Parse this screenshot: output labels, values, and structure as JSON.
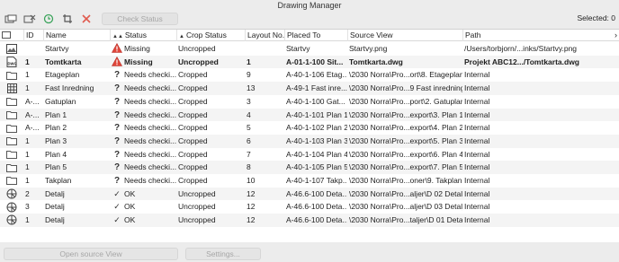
{
  "window": {
    "title": "Drawing Manager"
  },
  "toolbar": {
    "check_status_label": "Check Status",
    "selected_text": "Selected: 0",
    "icons": [
      "drawing-place-icon",
      "drawing-remove-icon",
      "refresh-icon",
      "crop-icon",
      "delete-x-icon"
    ],
    "delete_color": "#e05a4e",
    "refresh_color": "#3aa35a"
  },
  "columns": [
    "ID",
    "Name",
    "Status",
    "Crop Status",
    "Layout No.",
    "Placed To",
    "Source View",
    "Path"
  ],
  "rows": [
    {
      "type": "image",
      "id": "",
      "name": "Startvy",
      "status_icon": "warning",
      "status": "Missing",
      "crop": "Uncropped",
      "layout": "",
      "placed": "Startvy",
      "source": "Startvy.png",
      "path": "/Users/torbjorn/...inks/Startvy.png",
      "bold": false
    },
    {
      "type": "dwg",
      "id": "1",
      "name": "Tomtkarta",
      "status_icon": "warning",
      "status": "Missing",
      "crop": "Uncropped",
      "layout": "1",
      "placed": "A-01-1-100 Sit...",
      "source": "Tomtkarta.dwg",
      "path": "Projekt ABC12.../Tomtkarta.dwg",
      "bold": true
    },
    {
      "type": "folder",
      "id": "1",
      "name": "Etageplan",
      "status_icon": "question",
      "status": "Needs checki...",
      "crop": "Cropped",
      "layout": "9",
      "placed": "A-40-1-106 Etag...",
      "source": "\\2030 Norra\\Pro...ort\\8. Etageplan",
      "path": "Internal",
      "bold": false
    },
    {
      "type": "grid",
      "id": "1",
      "name": "Fast Inredning",
      "status_icon": "question",
      "status": "Needs checki...",
      "crop": "Cropped",
      "layout": "13",
      "placed": "A-49-1 Fast inre...",
      "source": "\\2030 Norra\\Pro...9 Fast inredning",
      "path": "Internal",
      "bold": false
    },
    {
      "type": "folder",
      "id": "A-...",
      "name": "Gatuplan",
      "status_icon": "question",
      "status": "Needs checki...",
      "crop": "Cropped",
      "layout": "3",
      "placed": "A-40-1-100 Gat...",
      "source": "\\2030 Norra\\Pro...port\\2. Gatuplan",
      "path": "Internal",
      "bold": false
    },
    {
      "type": "folder",
      "id": "A-...",
      "name": "Plan 1",
      "status_icon": "question",
      "status": "Needs checki...",
      "crop": "Cropped",
      "layout": "4",
      "placed": "A-40-1-101 Plan 1",
      "source": "\\2030 Norra\\Pro...export\\3. Plan 1",
      "path": "Internal",
      "bold": false
    },
    {
      "type": "folder",
      "id": "A-...",
      "name": "Plan 2",
      "status_icon": "question",
      "status": "Needs checki...",
      "crop": "Cropped",
      "layout": "5",
      "placed": "A-40-1-102 Plan 2",
      "source": "\\2030 Norra\\Pro...export\\4. Plan 2",
      "path": "Internal",
      "bold": false
    },
    {
      "type": "folder",
      "id": "1",
      "name": "Plan 3",
      "status_icon": "question",
      "status": "Needs checki...",
      "crop": "Cropped",
      "layout": "6",
      "placed": "A-40-1-103 Plan 3",
      "source": "\\2030 Norra\\Pro...export\\5. Plan 3",
      "path": "Internal",
      "bold": false
    },
    {
      "type": "folder",
      "id": "1",
      "name": "Plan 4",
      "status_icon": "question",
      "status": "Needs checki...",
      "crop": "Cropped",
      "layout": "7",
      "placed": "A-40-1-104 Plan 4",
      "source": "\\2030 Norra\\Pro...export\\6. Plan 4",
      "path": "Internal",
      "bold": false
    },
    {
      "type": "folder",
      "id": "1",
      "name": "Plan 5",
      "status_icon": "question",
      "status": "Needs checki...",
      "crop": "Cropped",
      "layout": "8",
      "placed": "A-40-1-105 Plan 5",
      "source": "\\2030 Norra\\Pro...export\\7. Plan 5",
      "path": "Internal",
      "bold": false
    },
    {
      "type": "folder",
      "id": "1",
      "name": "Takplan",
      "status_icon": "question",
      "status": "Needs checki...",
      "crop": "Cropped",
      "layout": "10",
      "placed": "A-40-1-107 Takp...",
      "source": "\\2030 Norra\\Pro...oner\\9. Takplan",
      "path": "Internal",
      "bold": false
    },
    {
      "type": "detail",
      "id": "2",
      "name": "Detalj",
      "status_icon": "ok",
      "status": "OK",
      "crop": "Uncropped",
      "layout": "12",
      "placed": "A-46.6-100 Deta...",
      "source": "\\2030 Norra\\Pro...aljer\\D 02 Detalj",
      "path": "Internal",
      "bold": false
    },
    {
      "type": "detail",
      "id": "3",
      "name": "Detalj",
      "status_icon": "ok",
      "status": "OK",
      "crop": "Uncropped",
      "layout": "12",
      "placed": "A-46.6-100 Deta...",
      "source": "\\2030 Norra\\Pro...aljer\\D 03 Detalj",
      "path": "Internal",
      "bold": false
    },
    {
      "type": "detail",
      "id": "1",
      "name": "Detalj",
      "status_icon": "ok",
      "status": "OK",
      "crop": "Uncropped",
      "layout": "12",
      "placed": "A-46.6-100 Deta...",
      "source": "\\2030 Norra\\Pro...taljer\\D 01 Detalj",
      "path": "Internal",
      "bold": false
    }
  ],
  "bottom": {
    "open_source_label": "Open source View",
    "settings_label": "Settings..."
  },
  "colors": {
    "warning": "#e0463a",
    "row_alt": "#f4f4f4",
    "disabled_text": "#a6a6a6"
  }
}
